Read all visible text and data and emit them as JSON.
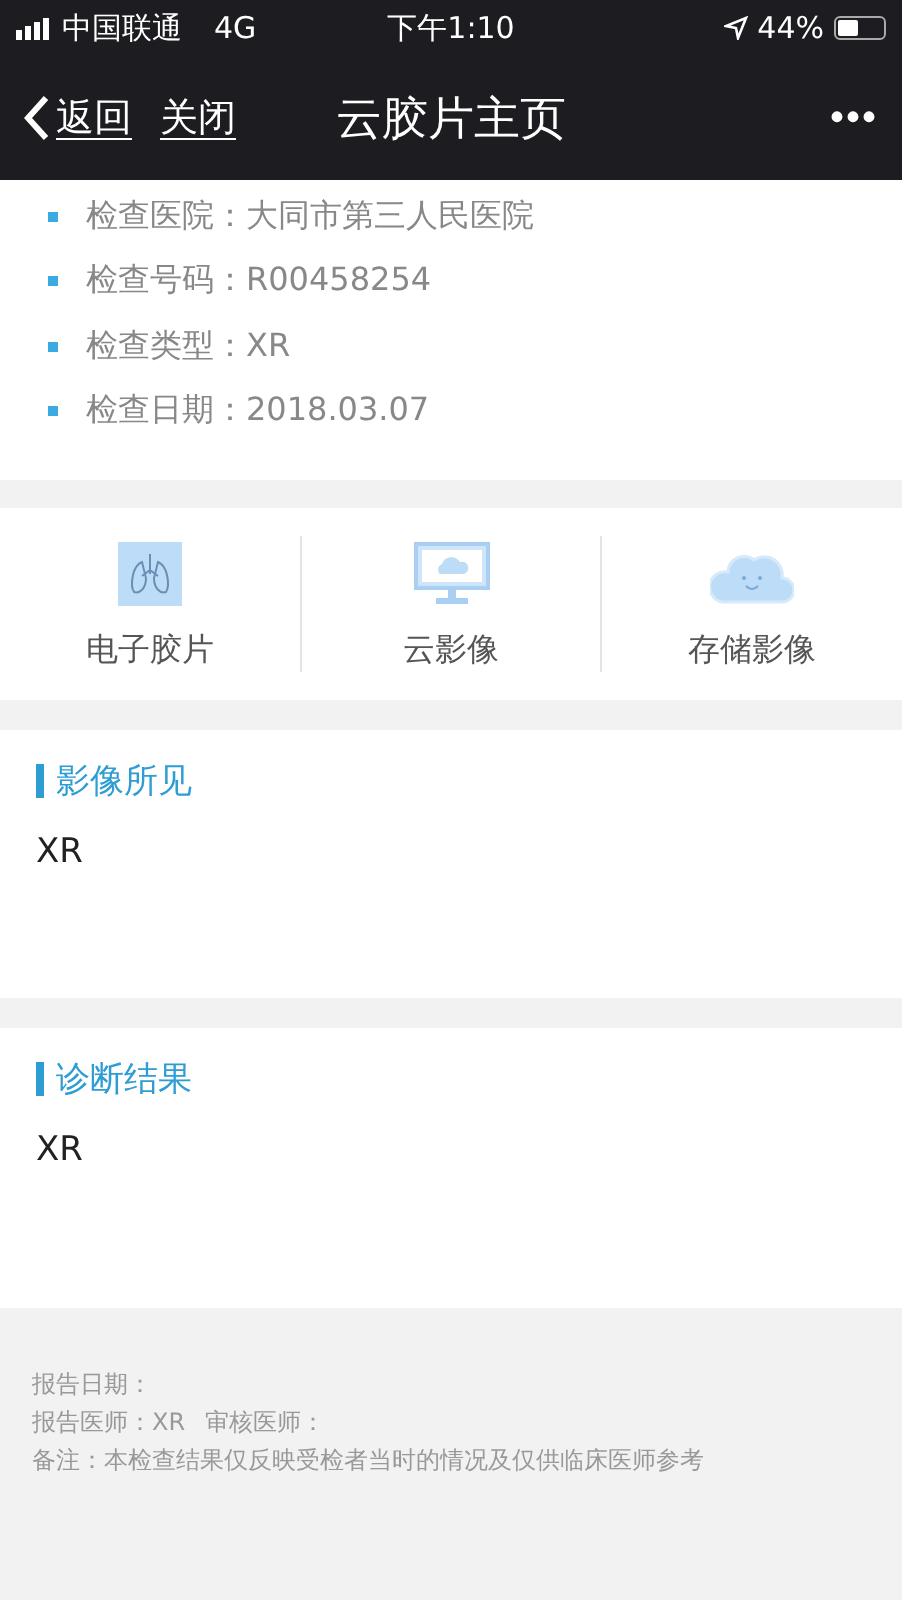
{
  "status_bar": {
    "carrier": "中国联通",
    "network": "4G",
    "time": "下午1:10",
    "battery": "44%"
  },
  "nav_bar": {
    "back": "返回",
    "close": "关闭",
    "title": "云胶片主页",
    "more": "•••"
  },
  "exam_info": [
    {
      "text": "检查医院：大同市第三人民医院"
    },
    {
      "text": "检查号码：R00458254"
    },
    {
      "text": "检查类型：XR"
    },
    {
      "text": "检查日期：2018.03.07"
    }
  ],
  "tiles": [
    {
      "label": "电子胶片",
      "kind": "film"
    },
    {
      "label": "云影像",
      "kind": "monitor"
    },
    {
      "label": "存储影像",
      "kind": "cloud"
    }
  ],
  "sections": [
    {
      "title": "影像所见",
      "body": "XR"
    },
    {
      "title": "诊断结果",
      "body": "XR"
    }
  ],
  "footer": [
    [
      "报告日期："
    ],
    [
      "报告医师：XR",
      "审核医师："
    ],
    [
      "备注：本检查结果仅反映受检者当时的情况及仅供临床医师参考"
    ]
  ]
}
